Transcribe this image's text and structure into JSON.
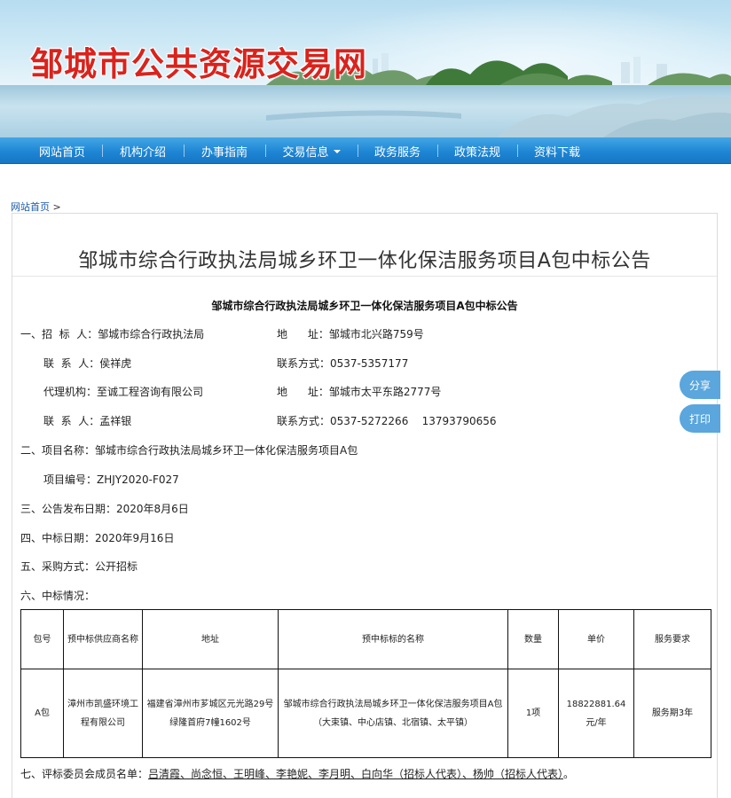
{
  "site": {
    "title": "邹城市公共资源交易网"
  },
  "nav": {
    "items": [
      {
        "label": "网站首页"
      },
      {
        "label": "机构介绍"
      },
      {
        "label": "办事指南"
      },
      {
        "label": "交易信息",
        "has_dropdown": true
      },
      {
        "label": "政务服务"
      },
      {
        "label": "政策法规"
      },
      {
        "label": "资料下载"
      }
    ]
  },
  "breadcrumb": {
    "home": "网站首页",
    "sep": ">"
  },
  "article": {
    "title": "邹城市综合行政执法局城乡环卫一体化保洁服务项目A包中标公告",
    "subtitle": "邹城市综合行政执法局城乡环卫一体化保洁服务项目A包中标公告",
    "s1_label": "一、招  标  人：",
    "s1_value": "邹城市综合行政执法局",
    "s1_addr_label": "地      址：",
    "s1_addr_value": "邹城市北兴路759号",
    "s1_contact_label": "联  系  人：",
    "s1_contact_value": "侯祥虎",
    "s1_phone_label": "联系方式：",
    "s1_phone_value": "0537-5357177",
    "agent_label": "代理机构：",
    "agent_value": "至诚工程咨询有限公司",
    "agent_addr_label": "地      址：",
    "agent_addr_value": "邹城市太平东路2777号",
    "agent_contact_label": "联  系  人：",
    "agent_contact_value": "孟祥银",
    "agent_phone_label": "联系方式：",
    "agent_phone_value": "0537-5272266    13793790656",
    "s2_label": "二、项目名称：",
    "s2_value": "邹城市综合行政执法局城乡环卫一体化保洁服务项目A包",
    "code_label": "项目编号：",
    "code_value": "ZHJY2020-F027",
    "s3": "三、公告发布日期：2020年8月6日",
    "s4": "四、中标日期：2020年9月16日",
    "s5": "五、采购方式：公开招标",
    "s6": "六、中标情况：",
    "table": {
      "headers": [
        "包号",
        "预中标供应商名称",
        "地址",
        "预中标标的名称",
        "数量",
        "单价",
        "服务要求"
      ],
      "row": [
        "A包",
        "漳州市凯盛环境工程有限公司",
        "福建省漳州市芗城区元光路29号绿隆首府7幢1602号",
        "邹城市综合行政执法局城乡环卫一体化保洁服务项目A包（大束镇、中心店镇、北宿镇、太平镇）",
        "1项",
        "18822881.64元/年",
        "服务期3年"
      ]
    },
    "s7_label": "七、评标委员会成员名单：",
    "s7_names": "吕清霞、尚念恒、王明峰、李艳妮、李月明、白向华（招标人代表）、杨帅（招标人代表）",
    "s7_end": "。"
  },
  "side": {
    "share": "分享",
    "print": "打印"
  }
}
